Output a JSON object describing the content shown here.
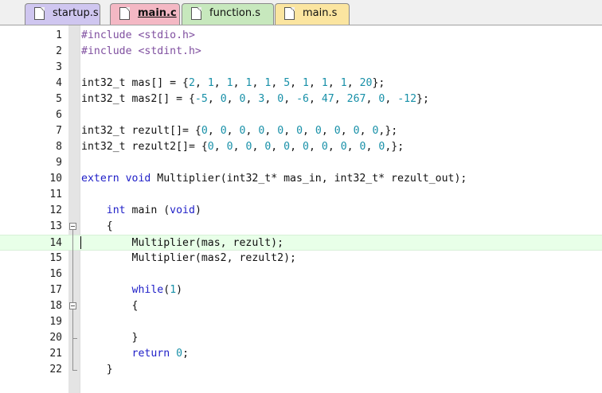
{
  "tabs": [
    {
      "label": "startup.s",
      "active": false
    },
    {
      "label": "main.c",
      "active": true
    },
    {
      "label": "function.s",
      "active": false
    },
    {
      "label": "main.s",
      "active": false
    }
  ],
  "colors": {
    "preprocessor": "#8050a0",
    "keyword": "#2020c8",
    "number": "#1890a8",
    "current_line": "#e8ffe8"
  },
  "editor": {
    "current_line": 14,
    "fold_markers": [
      13,
      18
    ],
    "lines": [
      {
        "n": "1",
        "tokens": [
          {
            "t": "#include <stdio.h>",
            "c": "pp"
          }
        ]
      },
      {
        "n": "2",
        "tokens": [
          {
            "t": "#include <stdint.h>",
            "c": "pp"
          }
        ]
      },
      {
        "n": "3",
        "tokens": []
      },
      {
        "n": "4",
        "tokens": [
          {
            "t": "int32_t mas[] = {",
            "c": "def"
          },
          {
            "t": "2",
            "c": "num"
          },
          {
            "t": ", ",
            "c": "def"
          },
          {
            "t": "1",
            "c": "num"
          },
          {
            "t": ", ",
            "c": "def"
          },
          {
            "t": "1",
            "c": "num"
          },
          {
            "t": ", ",
            "c": "def"
          },
          {
            "t": "1",
            "c": "num"
          },
          {
            "t": ", ",
            "c": "def"
          },
          {
            "t": "1",
            "c": "num"
          },
          {
            "t": ", ",
            "c": "def"
          },
          {
            "t": "5",
            "c": "num"
          },
          {
            "t": ", ",
            "c": "def"
          },
          {
            "t": "1",
            "c": "num"
          },
          {
            "t": ", ",
            "c": "def"
          },
          {
            "t": "1",
            "c": "num"
          },
          {
            "t": ", ",
            "c": "def"
          },
          {
            "t": "1",
            "c": "num"
          },
          {
            "t": ", ",
            "c": "def"
          },
          {
            "t": "20",
            "c": "num"
          },
          {
            "t": "};",
            "c": "def"
          }
        ]
      },
      {
        "n": "5",
        "tokens": [
          {
            "t": "int32_t mas2[] = {",
            "c": "def"
          },
          {
            "t": "-5",
            "c": "num"
          },
          {
            "t": ", ",
            "c": "def"
          },
          {
            "t": "0",
            "c": "num"
          },
          {
            "t": ", ",
            "c": "def"
          },
          {
            "t": "0",
            "c": "num"
          },
          {
            "t": ", ",
            "c": "def"
          },
          {
            "t": "3",
            "c": "num"
          },
          {
            "t": ", ",
            "c": "def"
          },
          {
            "t": "0",
            "c": "num"
          },
          {
            "t": ", ",
            "c": "def"
          },
          {
            "t": "-6",
            "c": "num"
          },
          {
            "t": ", ",
            "c": "def"
          },
          {
            "t": "47",
            "c": "num"
          },
          {
            "t": ", ",
            "c": "def"
          },
          {
            "t": "267",
            "c": "num"
          },
          {
            "t": ", ",
            "c": "def"
          },
          {
            "t": "0",
            "c": "num"
          },
          {
            "t": ", ",
            "c": "def"
          },
          {
            "t": "-12",
            "c": "num"
          },
          {
            "t": "};",
            "c": "def"
          }
        ]
      },
      {
        "n": "6",
        "tokens": []
      },
      {
        "n": "7",
        "tokens": [
          {
            "t": "int32_t rezult[]= {",
            "c": "def"
          },
          {
            "t": "0",
            "c": "num"
          },
          {
            "t": ", ",
            "c": "def"
          },
          {
            "t": "0",
            "c": "num"
          },
          {
            "t": ", ",
            "c": "def"
          },
          {
            "t": "0",
            "c": "num"
          },
          {
            "t": ", ",
            "c": "def"
          },
          {
            "t": "0",
            "c": "num"
          },
          {
            "t": ", ",
            "c": "def"
          },
          {
            "t": "0",
            "c": "num"
          },
          {
            "t": ", ",
            "c": "def"
          },
          {
            "t": "0",
            "c": "num"
          },
          {
            "t": ", ",
            "c": "def"
          },
          {
            "t": "0",
            "c": "num"
          },
          {
            "t": ", ",
            "c": "def"
          },
          {
            "t": "0",
            "c": "num"
          },
          {
            "t": ", ",
            "c": "def"
          },
          {
            "t": "0",
            "c": "num"
          },
          {
            "t": ", ",
            "c": "def"
          },
          {
            "t": "0",
            "c": "num"
          },
          {
            "t": ",};",
            "c": "def"
          }
        ]
      },
      {
        "n": "8",
        "tokens": [
          {
            "t": "int32_t rezult2[]= {",
            "c": "def"
          },
          {
            "t": "0",
            "c": "num"
          },
          {
            "t": ", ",
            "c": "def"
          },
          {
            "t": "0",
            "c": "num"
          },
          {
            "t": ", ",
            "c": "def"
          },
          {
            "t": "0",
            "c": "num"
          },
          {
            "t": ", ",
            "c": "def"
          },
          {
            "t": "0",
            "c": "num"
          },
          {
            "t": ", ",
            "c": "def"
          },
          {
            "t": "0",
            "c": "num"
          },
          {
            "t": ", ",
            "c": "def"
          },
          {
            "t": "0",
            "c": "num"
          },
          {
            "t": ", ",
            "c": "def"
          },
          {
            "t": "0",
            "c": "num"
          },
          {
            "t": ", ",
            "c": "def"
          },
          {
            "t": "0",
            "c": "num"
          },
          {
            "t": ", ",
            "c": "def"
          },
          {
            "t": "0",
            "c": "num"
          },
          {
            "t": ", ",
            "c": "def"
          },
          {
            "t": "0",
            "c": "num"
          },
          {
            "t": ",};",
            "c": "def"
          }
        ]
      },
      {
        "n": "9",
        "tokens": []
      },
      {
        "n": "10",
        "tokens": [
          {
            "t": "extern",
            "c": "kw"
          },
          {
            "t": " ",
            "c": "def"
          },
          {
            "t": "void",
            "c": "kw"
          },
          {
            "t": " Multiplier(int32_t* mas_in, int32_t* rezult_out);",
            "c": "def"
          }
        ]
      },
      {
        "n": "11",
        "tokens": []
      },
      {
        "n": "12",
        "tokens": [
          {
            "t": "    ",
            "c": "def"
          },
          {
            "t": "int",
            "c": "kw"
          },
          {
            "t": " main (",
            "c": "def"
          },
          {
            "t": "void",
            "c": "kw"
          },
          {
            "t": ")",
            "c": "def"
          }
        ]
      },
      {
        "n": "13",
        "tokens": [
          {
            "t": "    {",
            "c": "def"
          }
        ]
      },
      {
        "n": "14",
        "tokens": [
          {
            "t": "        Multiplier(mas, rezult);",
            "c": "def"
          }
        ]
      },
      {
        "n": "15",
        "tokens": [
          {
            "t": "        Multiplier(mas2, rezult2);",
            "c": "def"
          }
        ]
      },
      {
        "n": "16",
        "tokens": []
      },
      {
        "n": "17",
        "tokens": [
          {
            "t": "        ",
            "c": "def"
          },
          {
            "t": "while",
            "c": "kw"
          },
          {
            "t": "(",
            "c": "def"
          },
          {
            "t": "1",
            "c": "num"
          },
          {
            "t": ")",
            "c": "def"
          }
        ]
      },
      {
        "n": "18",
        "tokens": [
          {
            "t": "        {",
            "c": "def"
          }
        ]
      },
      {
        "n": "19",
        "tokens": []
      },
      {
        "n": "20",
        "tokens": [
          {
            "t": "        }",
            "c": "def"
          }
        ]
      },
      {
        "n": "21",
        "tokens": [
          {
            "t": "        ",
            "c": "def"
          },
          {
            "t": "return",
            "c": "kw"
          },
          {
            "t": " ",
            "c": "def"
          },
          {
            "t": "0",
            "c": "num"
          },
          {
            "t": ";",
            "c": "def"
          }
        ]
      },
      {
        "n": "22",
        "tokens": [
          {
            "t": "    }",
            "c": "def"
          }
        ]
      }
    ]
  }
}
